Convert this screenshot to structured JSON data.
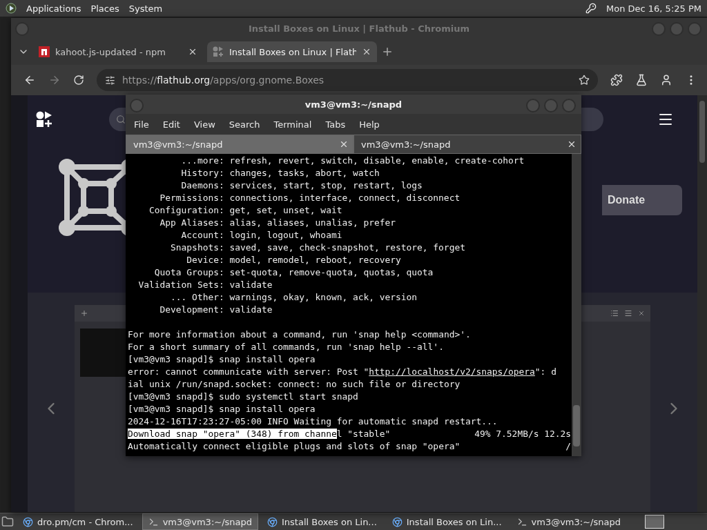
{
  "top_panel": {
    "menus": [
      "Applications",
      "Places",
      "System"
    ],
    "clock": "Mon Dec 16,  5:25 PM"
  },
  "browser": {
    "title": "Install Boxes on Linux | Flathub - Chromium",
    "tabs": [
      {
        "label": "kahoot.js-updated - npm",
        "kind": "npm",
        "selected": false
      },
      {
        "label": "Install Boxes on Linux | Flath",
        "kind": "flathub",
        "selected": true
      }
    ],
    "url": {
      "scheme": "https://",
      "domain": "flathub.org",
      "path": "/apps/org.gnome.Boxes"
    },
    "page": {
      "donate": "Donate"
    }
  },
  "terminal": {
    "title": "vm3@vm3:~/snapd",
    "menus": [
      "File",
      "Edit",
      "View",
      "Search",
      "Terminal",
      "Tabs",
      "Help"
    ],
    "tabs": [
      {
        "label": "vm3@vm3:~/snapd",
        "selected": true
      },
      {
        "label": "vm3@vm3:~/snapd",
        "selected": false
      }
    ],
    "lines": [
      {
        "kind": "help",
        "label": "...more:",
        "value": "refresh, revert, switch, disable, enable, create-cohort"
      },
      {
        "kind": "help",
        "label": "History:",
        "value": "changes, tasks, abort, watch"
      },
      {
        "kind": "help",
        "label": "Daemons:",
        "value": "services, start, stop, restart, logs"
      },
      {
        "kind": "help",
        "label": "Permissions:",
        "value": "connections, interface, connect, disconnect"
      },
      {
        "kind": "help",
        "label": "Configuration:",
        "value": "get, set, unset, wait"
      },
      {
        "kind": "help",
        "label": "App Aliases:",
        "value": "alias, aliases, unalias, prefer"
      },
      {
        "kind": "help",
        "label": "Account:",
        "value": "login, logout, whoami"
      },
      {
        "kind": "help",
        "label": "Snapshots:",
        "value": "saved, save, check-snapshot, restore, forget"
      },
      {
        "kind": "help",
        "label": "Device:",
        "value": "model, remodel, reboot, recovery"
      },
      {
        "kind": "help",
        "label": "Quota Groups:",
        "value": "set-quota, remove-quota, quotas, quota"
      },
      {
        "kind": "help",
        "label": "Validation Sets:",
        "value": "validate"
      },
      {
        "kind": "help",
        "label": "... Other:",
        "value": "warnings, okay, known, ack, version"
      },
      {
        "kind": "help",
        "label": "Development:",
        "value": "validate"
      },
      {
        "kind": "blank"
      },
      {
        "kind": "plain",
        "text": "For more information about a command, run 'snap help <command>'."
      },
      {
        "kind": "plain",
        "text": "For a short summary of all commands, run 'snap help --all'."
      },
      {
        "kind": "plain",
        "text": "[vm3@vm3 snapd]$ snap install opera"
      },
      {
        "kind": "link",
        "before": "error: cannot communicate with server: Post \"",
        "link": "http://localhost/v2/snaps/opera",
        "after": "\": d"
      },
      {
        "kind": "plain",
        "text": "ial unix /run/snapd.socket: connect: no such file or directory"
      },
      {
        "kind": "plain",
        "text": "[vm3@vm3 snapd]$ sudo systemctl start snapd"
      },
      {
        "kind": "plain",
        "text": "[vm3@vm3 snapd]$ snap install opera"
      },
      {
        "kind": "plain",
        "text": "2024-12-16T17:23:27-05:00 INFO Waiting for automatic snapd restart..."
      },
      {
        "kind": "progress",
        "selected": "Download snap \"opera\" (348) from channe",
        "text": "l \"stable\"",
        "progress": "49% 7.52MB/s 12.2s"
      },
      {
        "kind": "status",
        "text": "Automatically connect eligible plugs and slots of snap \"opera\"",
        "spinner": "/"
      }
    ]
  },
  "taskbar": {
    "items": [
      {
        "label": "dro.pm/cm - Chrom...",
        "kind": "browser",
        "selected": false
      },
      {
        "label": "vm3@vm3:~/snapd",
        "kind": "terminal",
        "selected": true
      },
      {
        "label": "Install Boxes on Lin...",
        "kind": "browser",
        "selected": false
      },
      {
        "label": "Install Boxes on Lin...",
        "kind": "browser",
        "selected": false
      },
      {
        "label": "vm3@vm3:~/snapd",
        "kind": "terminal",
        "selected": false
      }
    ]
  }
}
